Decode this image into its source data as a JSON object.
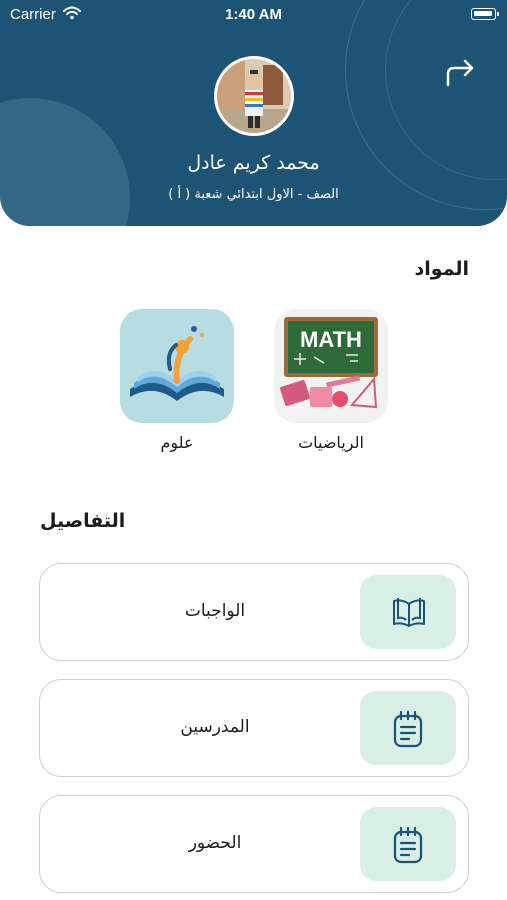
{
  "status_bar": {
    "carrier": "Carrier",
    "time": "1:40 AM"
  },
  "profile": {
    "name": "محمد كريم عادل",
    "class_info": "الصف - الاول ابتدائي شعبة ( أ )"
  },
  "subjects": {
    "title": "المواد",
    "items": [
      {
        "label": "الرياضيات",
        "badge_text": "MATH"
      },
      {
        "label": "علوم"
      }
    ]
  },
  "details": {
    "title": "التفاصيل",
    "items": [
      {
        "label": "الواجبات",
        "icon": "open-book-icon"
      },
      {
        "label": "المدرسين",
        "icon": "notepad-icon"
      },
      {
        "label": "الحضور",
        "icon": "notepad-icon"
      }
    ]
  },
  "colors": {
    "header": "#1d5375",
    "icon_bg": "#d8efe6",
    "icon_stroke": "#1d5375"
  }
}
